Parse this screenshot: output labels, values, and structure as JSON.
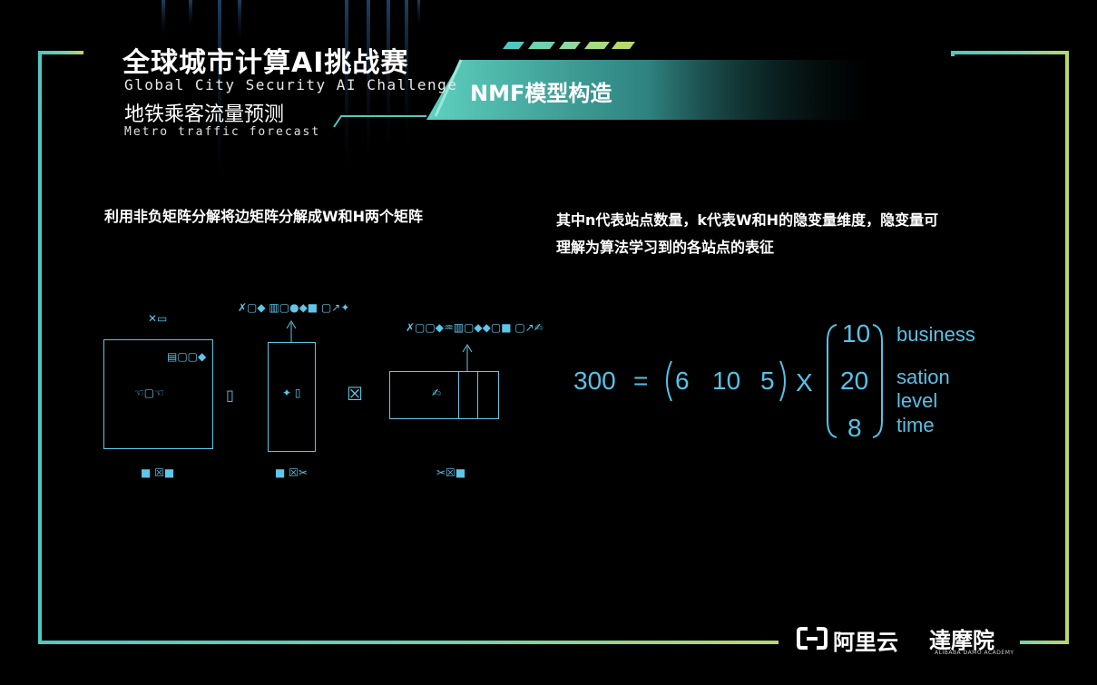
{
  "header": {
    "title_cn": "全球城市计算AI挑战赛",
    "title_en": "Global City Security AI Challenge",
    "subtitle_cn": "地铁乘客流量预测",
    "subtitle_en": "Metro traffic forecast"
  },
  "slide_title": "NMF模型构造",
  "left_text": "利用非负矩阵分解将边矩阵分解成W和H两个矩阵",
  "right_text_line1": "其中n代表站点数量，k代表W和H的隐变量维度，隐变量可",
  "right_text_line2": "理解为算法学习到的各站点的表征",
  "diagram": {
    "v_top": "✕▭",
    "v_topright": "▤▢▢◆",
    "v_center": "☜▢☜",
    "v_bottom": "■ ☒■",
    "approx": "▯",
    "w_top": "✗▢◆ ▥▢●◆■ ▢↗✦",
    "w_center": "✦ ▯",
    "w_bottom": "■ ☒✂",
    "times": "☒",
    "h_top": "✗▢▢◆♒▥▢◆◆▢■ ▢↗✍",
    "h_center": "✍",
    "h_bottom": "✂☒■"
  },
  "equation": {
    "lhs": "300",
    "equals": "=",
    "row_vector": [
      "6",
      "10",
      "5"
    ],
    "op": "X",
    "col_vector": [
      "10",
      "20",
      "8"
    ],
    "labels": [
      "business",
      "sation level",
      "time"
    ]
  },
  "footer": {
    "aliyun_logo": "[-]",
    "aliyun": "阿里云",
    "damo": "達摩院",
    "damo_en": "ALIBABA DAMO ACADEMY"
  },
  "colors": {
    "accent_cyan": "#5ec6e8",
    "frame_teal": "#4fc9c0",
    "frame_green": "#b8d86a"
  }
}
